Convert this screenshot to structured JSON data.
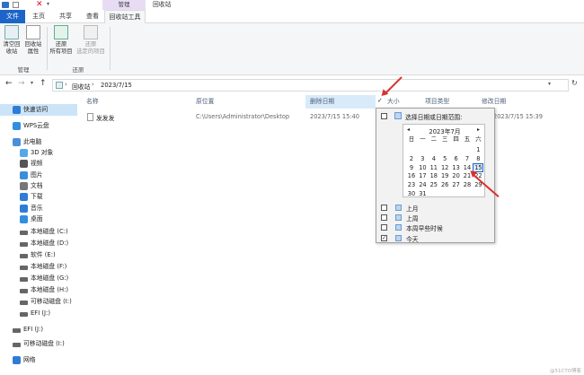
{
  "ribbon": {
    "tabs": {
      "file": "文件",
      "home": "主页",
      "share": "共享",
      "view": "查看",
      "tools": "回收站工具"
    },
    "context_group": "管理",
    "context_title": "回收站",
    "buttons": {
      "empty": "清空回\n收站",
      "props": "回收站\n属性",
      "restore_all": "还原\n所有项目",
      "restore_sel": "还原\n选定的项目"
    },
    "groups": {
      "manage": "管理",
      "restore": "还原"
    }
  },
  "address": {
    "crumb1": "回收站",
    "sep": "›",
    "crumb2": "2023/7/15"
  },
  "columns": {
    "name": "名称",
    "location": "原位置",
    "deleted": "删除日期",
    "size": "大小",
    "type": "项目类型",
    "modified": "修改日期"
  },
  "files": [
    {
      "name": "发发发",
      "location": "C:\\Users\\Administrator\\Desktop",
      "deleted": "2023/7/15 15:40",
      "modified": "2023/7/15 15:39"
    }
  ],
  "sidebar": {
    "items": [
      {
        "label": "快速访问",
        "icon": "star-icon"
      },
      {
        "label": "WPS云盘",
        "icon": "cloud-icon"
      },
      {
        "label": "此电脑",
        "icon": "computer-icon"
      },
      {
        "label": "3D 对象",
        "icon": "cube-icon"
      },
      {
        "label": "视频",
        "icon": "video-icon"
      },
      {
        "label": "图片",
        "icon": "picture-icon"
      },
      {
        "label": "文档",
        "icon": "document-icon"
      },
      {
        "label": "下载",
        "icon": "download-icon"
      },
      {
        "label": "音乐",
        "icon": "music-icon"
      },
      {
        "label": "桌面",
        "icon": "desktop-icon"
      },
      {
        "label": "本地磁盘 (C:)",
        "icon": "drive-icon"
      },
      {
        "label": "本地磁盘 (D:)",
        "icon": "drive-icon"
      },
      {
        "label": "软件 (E:)",
        "icon": "drive-icon"
      },
      {
        "label": "本地磁盘 (F:)",
        "icon": "drive-icon"
      },
      {
        "label": "本地磁盘 (G:)",
        "icon": "drive-icon"
      },
      {
        "label": "本地磁盘 (H:)",
        "icon": "drive-icon"
      },
      {
        "label": "可移动磁盘 (I:)",
        "icon": "drive-icon"
      },
      {
        "label": "EFI (J:)",
        "icon": "drive-icon"
      },
      {
        "label": "EFI (J:)",
        "icon": "drive-icon"
      },
      {
        "label": "可移动磁盘 (I:)",
        "icon": "drive-icon"
      },
      {
        "label": "网络",
        "icon": "network-icon"
      }
    ]
  },
  "filter": {
    "range_label": "选择日期或日期范围:",
    "month_title": "2023年7月",
    "weekdays": [
      "日",
      "一",
      "二",
      "三",
      "四",
      "五",
      "六"
    ],
    "days": [
      "1",
      "2",
      "3",
      "4",
      "5",
      "6",
      "7",
      "8",
      "9",
      "10",
      "11",
      "12",
      "13",
      "14",
      "15",
      "16",
      "17",
      "18",
      "19",
      "20",
      "21",
      "22",
      "23",
      "24",
      "25",
      "26",
      "27",
      "28",
      "29",
      "30",
      "31"
    ],
    "first_weekday": 6,
    "selected_day": 15,
    "options": [
      {
        "label": "上月",
        "checked": false
      },
      {
        "label": "上周",
        "checked": false
      },
      {
        "label": "本周早些时候",
        "checked": false
      },
      {
        "label": "今天",
        "checked": true
      }
    ]
  },
  "watermark": "@51CTO博客"
}
